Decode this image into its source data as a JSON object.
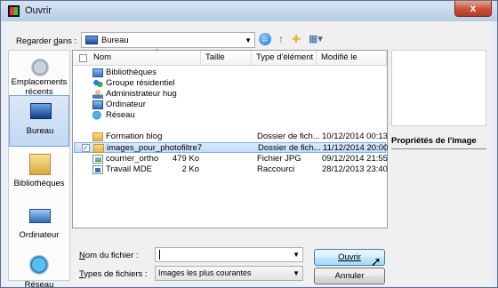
{
  "window": {
    "title": "Ouvrir",
    "close_glyph": "x"
  },
  "lookin": {
    "label": "Regarder dans :",
    "value": "Bureau"
  },
  "toolbar": {
    "back_glyph": "←",
    "up_glyph": "↑",
    "new_folder_glyph": "✚",
    "view_glyph": "▦▾"
  },
  "places": [
    {
      "label": "Emplacements récents",
      "icon": "recent-places-icon"
    },
    {
      "label": "Bureau",
      "icon": "desktop-icon"
    },
    {
      "label": "Bibliothèques",
      "icon": "libraries-icon"
    },
    {
      "label": "Ordinateur",
      "icon": "computer-icon"
    },
    {
      "label": "Réseau",
      "icon": "network-icon"
    }
  ],
  "columns": {
    "name": "Nom",
    "size": "Taille",
    "type": "Type d'élément",
    "date": "Modifié le"
  },
  "files": [
    {
      "name": "Bibliothèques",
      "size": "",
      "type": "",
      "date": "",
      "icon": "library-icon"
    },
    {
      "name": "Groupe résidentiel",
      "size": "",
      "type": "",
      "date": "",
      "icon": "homegroup-icon"
    },
    {
      "name": "Administrateur hug",
      "size": "",
      "type": "",
      "date": "",
      "icon": "user-icon"
    },
    {
      "name": "Ordinateur",
      "size": "",
      "type": "",
      "date": "",
      "icon": "computer-icon"
    },
    {
      "name": "Réseau",
      "size": "",
      "type": "",
      "date": "",
      "icon": "network-icon"
    },
    {
      "name": "Formation blog",
      "size": "",
      "type": "Dossier de fich...",
      "date": "10/12/2014 00:13",
      "icon": "folder-icon"
    },
    {
      "name": "images_pour_photofiltre7",
      "size": "",
      "type": "Dossier de fich...",
      "date": "11/12/2014 20:00",
      "icon": "folder-icon",
      "selected": true
    },
    {
      "name": "courrier_ortho",
      "size": "479 Ko",
      "type": "Fichier JPG",
      "date": "09/12/2014 21:55",
      "icon": "jpg-file-icon"
    },
    {
      "name": "Travail MDE",
      "size": "2 Ko",
      "type": "Raccourci",
      "date": "28/12/2013 23:40",
      "icon": "shortcut-icon"
    }
  ],
  "preview": {
    "props_label": "Propriétés de l'image"
  },
  "filename": {
    "label": "Nom du fichier :",
    "value": ""
  },
  "filetype": {
    "label": "Types de fichiers :",
    "value": "Images les plus courantes"
  },
  "buttons": {
    "open": "Ouvrir",
    "cancel": "Annuler"
  }
}
